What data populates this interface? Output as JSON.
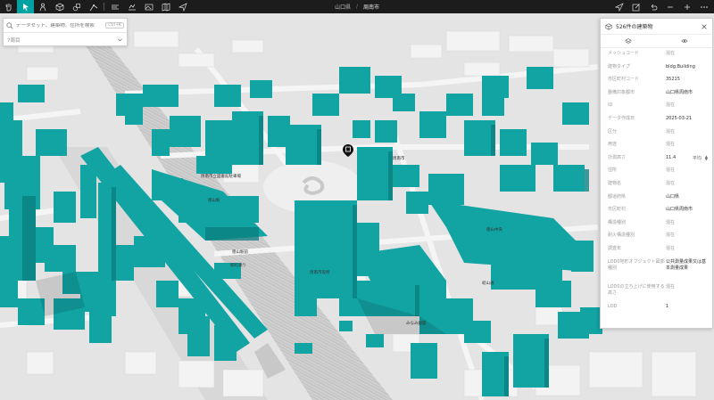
{
  "toolbar": {
    "tools_left": [
      "hand-icon",
      "pointer-icon",
      "person-icon",
      "box-icon",
      "shapes-icon",
      "line-icon",
      "layers-icon",
      "horizon-icon",
      "image-icon",
      "map-icon",
      "send-icon"
    ],
    "breadcrumb": {
      "parent": "山口県",
      "separator": "/",
      "current": "周南市"
    },
    "tools_right": [
      "location-icon",
      "edit-icon",
      "undo-icon",
      "minus-icon",
      "plus-icon",
      "more-icon"
    ]
  },
  "search": {
    "placeholder": "データセット、建築物、住所を検索",
    "shortcut": "Ctrl+K",
    "select_value": "7周目"
  },
  "panel": {
    "title": "526件の建築物",
    "rows": [
      {
        "key": "メッシュコード",
        "value": "混在"
      },
      {
        "key": "建物タイプ",
        "value": "bldg:Building"
      },
      {
        "key": "市区町村コード",
        "value": "35215"
      },
      {
        "key": "整備対象都市",
        "value": "山口県周南市"
      },
      {
        "key": "ID",
        "value": "混在"
      },
      {
        "key": "データ作成日",
        "value": "2025-03-21"
      },
      {
        "key": "区分",
        "value": "混在"
      },
      {
        "key": "用途",
        "value": "混在"
      },
      {
        "key": "計測高さ",
        "value": "11.4",
        "unit": "平均"
      },
      {
        "key": "住所",
        "value": "混在"
      },
      {
        "key": "建物名",
        "value": "混在"
      },
      {
        "key": "都道府県",
        "value": "山口県"
      },
      {
        "key": "市区町村",
        "value": "山口県周南市"
      },
      {
        "key": "構造種別",
        "value": "混在"
      },
      {
        "key": "耐火構造種別",
        "value": "混在"
      },
      {
        "key": "調査年",
        "value": "混在"
      },
      {
        "key": "LOD0地形オブジェクト図郭種別",
        "value": "公共測量成果又は基本測量成果"
      },
      {
        "key": "LOD0の立ち上げに使用する高さ",
        "value": "混在"
      },
      {
        "key": "LOD",
        "value": "1"
      }
    ]
  },
  "map_labels": [
    {
      "text": "周南市立図書館駐車場"
    },
    {
      "text": "徳山駅"
    },
    {
      "text": "徳山駅前"
    },
    {
      "text": "新町通り"
    },
    {
      "text": "みなみ銀座"
    },
    {
      "text": "周南市役所"
    },
    {
      "text": "周南市"
    },
    {
      "text": "岐山通"
    },
    {
      "text": "徳山中央"
    }
  ],
  "colors": {
    "building": "#11a3a3",
    "accent": "#00a3a3",
    "toolbar": "#1c1c1c"
  }
}
